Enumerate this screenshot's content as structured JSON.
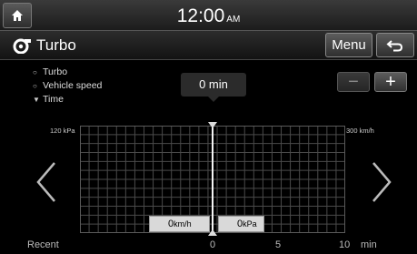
{
  "statusbar": {
    "time": "12:00",
    "ampm": "AM"
  },
  "header": {
    "title": "Turbo",
    "menu_label": "Menu"
  },
  "legend": [
    {
      "label": "Turbo",
      "marker": "circle"
    },
    {
      "label": "Vehicle speed",
      "marker": "circle"
    },
    {
      "label": "Time",
      "marker": "triangle-down"
    }
  ],
  "time_bubble": "0 min",
  "zoom": {
    "minus_label": "−",
    "plus_label": "+"
  },
  "axis": {
    "left_max": "120 kPa",
    "right_max": "300 km/h"
  },
  "readouts": {
    "speed": {
      "value": "0",
      "unit": "km/h"
    },
    "pressure": {
      "value": "0",
      "unit": "kPa"
    }
  },
  "footer": {
    "recent": "Recent",
    "ticks": [
      "0",
      "5",
      "10"
    ],
    "unit": "min"
  },
  "colors": {
    "grid": "#4a4a4a",
    "background": "#000000",
    "readout_bg": "#d9d9d9"
  }
}
